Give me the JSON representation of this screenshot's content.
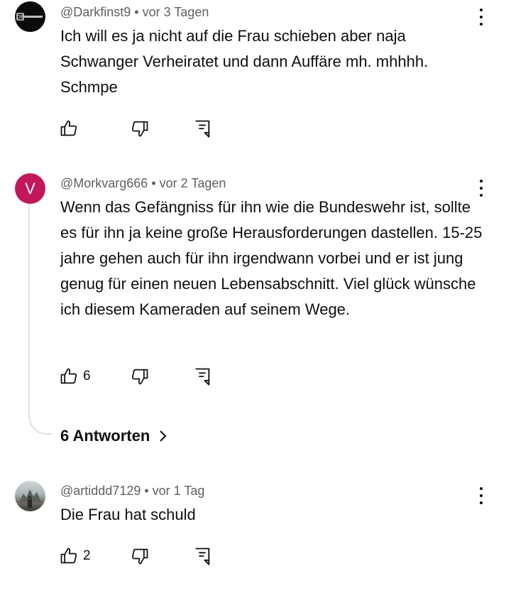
{
  "comments": [
    {
      "author": "@Darkfinst9",
      "time": "vor 3 Tagen",
      "meta": "@Darkfinst9 • vor 3 Tagen",
      "avatar_label": "DB",
      "text": "Ich will es ja nicht auf die Frau schieben aber naja Schwanger Verheiratet und dann Auffäre mh. mhhhh. Schmpe",
      "likes": ""
    },
    {
      "author": "@Morkvarg666",
      "time": "vor 2 Tagen",
      "meta": "@Morkvarg666 • vor 2 Tagen",
      "avatar_label": "V",
      "text": "Wenn das Gefängniss für ihn wie die Bundeswehr ist, sollte es für ihn ja keine große Herausforderungen dastellen. 15-25 jahre gehen auch für ihn irgendwann vorbei und er ist jung genug für einen neuen Lebensabschnitt. Viel glück wünsche ich diesem Kameraden auf seinem Wege.",
      "likes": "6",
      "replies_label": "6 Antworten"
    },
    {
      "author": "@artiddd7129",
      "time": "vor 1 Tag",
      "meta": "@artiddd7129 • vor 1 Tag",
      "text": "Die Frau hat schuld",
      "likes": "2"
    }
  ],
  "icons": {
    "like": "thumbs-up-icon",
    "dislike": "thumbs-down-icon",
    "reply": "reply-comment-icon",
    "more": "more-vertical-icon",
    "chevron": "chevron-right-icon"
  },
  "colors": {
    "text": "#0f0f0f",
    "secondary": "#606060",
    "avatar_v": "#c2185b",
    "thread_line": "#e0e0e0"
  }
}
